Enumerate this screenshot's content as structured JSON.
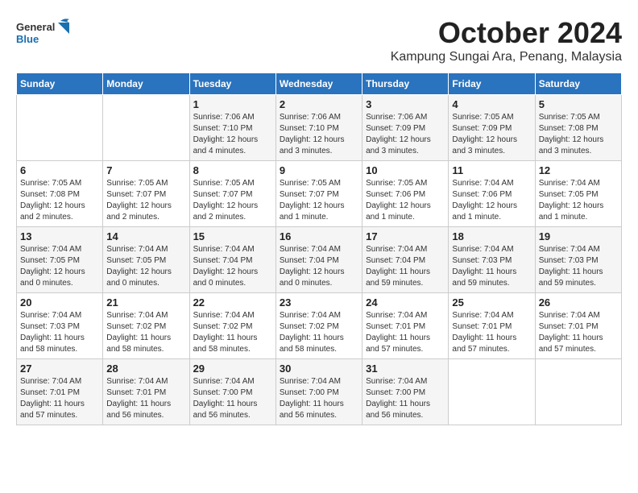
{
  "header": {
    "logo_general": "General",
    "logo_blue": "Blue",
    "month": "October 2024",
    "location": "Kampung Sungai Ara, Penang, Malaysia"
  },
  "weekdays": [
    "Sunday",
    "Monday",
    "Tuesday",
    "Wednesday",
    "Thursday",
    "Friday",
    "Saturday"
  ],
  "weeks": [
    [
      {
        "day": "",
        "info": ""
      },
      {
        "day": "",
        "info": ""
      },
      {
        "day": "1",
        "info": "Sunrise: 7:06 AM\nSunset: 7:10 PM\nDaylight: 12 hours and 4 minutes."
      },
      {
        "day": "2",
        "info": "Sunrise: 7:06 AM\nSunset: 7:10 PM\nDaylight: 12 hours and 3 minutes."
      },
      {
        "day": "3",
        "info": "Sunrise: 7:06 AM\nSunset: 7:09 PM\nDaylight: 12 hours and 3 minutes."
      },
      {
        "day": "4",
        "info": "Sunrise: 7:05 AM\nSunset: 7:09 PM\nDaylight: 12 hours and 3 minutes."
      },
      {
        "day": "5",
        "info": "Sunrise: 7:05 AM\nSunset: 7:08 PM\nDaylight: 12 hours and 3 minutes."
      }
    ],
    [
      {
        "day": "6",
        "info": "Sunrise: 7:05 AM\nSunset: 7:08 PM\nDaylight: 12 hours and 2 minutes."
      },
      {
        "day": "7",
        "info": "Sunrise: 7:05 AM\nSunset: 7:07 PM\nDaylight: 12 hours and 2 minutes."
      },
      {
        "day": "8",
        "info": "Sunrise: 7:05 AM\nSunset: 7:07 PM\nDaylight: 12 hours and 2 minutes."
      },
      {
        "day": "9",
        "info": "Sunrise: 7:05 AM\nSunset: 7:07 PM\nDaylight: 12 hours and 1 minute."
      },
      {
        "day": "10",
        "info": "Sunrise: 7:05 AM\nSunset: 7:06 PM\nDaylight: 12 hours and 1 minute."
      },
      {
        "day": "11",
        "info": "Sunrise: 7:04 AM\nSunset: 7:06 PM\nDaylight: 12 hours and 1 minute."
      },
      {
        "day": "12",
        "info": "Sunrise: 7:04 AM\nSunset: 7:05 PM\nDaylight: 12 hours and 1 minute."
      }
    ],
    [
      {
        "day": "13",
        "info": "Sunrise: 7:04 AM\nSunset: 7:05 PM\nDaylight: 12 hours and 0 minutes."
      },
      {
        "day": "14",
        "info": "Sunrise: 7:04 AM\nSunset: 7:05 PM\nDaylight: 12 hours and 0 minutes."
      },
      {
        "day": "15",
        "info": "Sunrise: 7:04 AM\nSunset: 7:04 PM\nDaylight: 12 hours and 0 minutes."
      },
      {
        "day": "16",
        "info": "Sunrise: 7:04 AM\nSunset: 7:04 PM\nDaylight: 12 hours and 0 minutes."
      },
      {
        "day": "17",
        "info": "Sunrise: 7:04 AM\nSunset: 7:04 PM\nDaylight: 11 hours and 59 minutes."
      },
      {
        "day": "18",
        "info": "Sunrise: 7:04 AM\nSunset: 7:03 PM\nDaylight: 11 hours and 59 minutes."
      },
      {
        "day": "19",
        "info": "Sunrise: 7:04 AM\nSunset: 7:03 PM\nDaylight: 11 hours and 59 minutes."
      }
    ],
    [
      {
        "day": "20",
        "info": "Sunrise: 7:04 AM\nSunset: 7:03 PM\nDaylight: 11 hours and 58 minutes."
      },
      {
        "day": "21",
        "info": "Sunrise: 7:04 AM\nSunset: 7:02 PM\nDaylight: 11 hours and 58 minutes."
      },
      {
        "day": "22",
        "info": "Sunrise: 7:04 AM\nSunset: 7:02 PM\nDaylight: 11 hours and 58 minutes."
      },
      {
        "day": "23",
        "info": "Sunrise: 7:04 AM\nSunset: 7:02 PM\nDaylight: 11 hours and 58 minutes."
      },
      {
        "day": "24",
        "info": "Sunrise: 7:04 AM\nSunset: 7:01 PM\nDaylight: 11 hours and 57 minutes."
      },
      {
        "day": "25",
        "info": "Sunrise: 7:04 AM\nSunset: 7:01 PM\nDaylight: 11 hours and 57 minutes."
      },
      {
        "day": "26",
        "info": "Sunrise: 7:04 AM\nSunset: 7:01 PM\nDaylight: 11 hours and 57 minutes."
      }
    ],
    [
      {
        "day": "27",
        "info": "Sunrise: 7:04 AM\nSunset: 7:01 PM\nDaylight: 11 hours and 57 minutes."
      },
      {
        "day": "28",
        "info": "Sunrise: 7:04 AM\nSunset: 7:01 PM\nDaylight: 11 hours and 56 minutes."
      },
      {
        "day": "29",
        "info": "Sunrise: 7:04 AM\nSunset: 7:00 PM\nDaylight: 11 hours and 56 minutes."
      },
      {
        "day": "30",
        "info": "Sunrise: 7:04 AM\nSunset: 7:00 PM\nDaylight: 11 hours and 56 minutes."
      },
      {
        "day": "31",
        "info": "Sunrise: 7:04 AM\nSunset: 7:00 PM\nDaylight: 11 hours and 56 minutes."
      },
      {
        "day": "",
        "info": ""
      },
      {
        "day": "",
        "info": ""
      }
    ]
  ]
}
